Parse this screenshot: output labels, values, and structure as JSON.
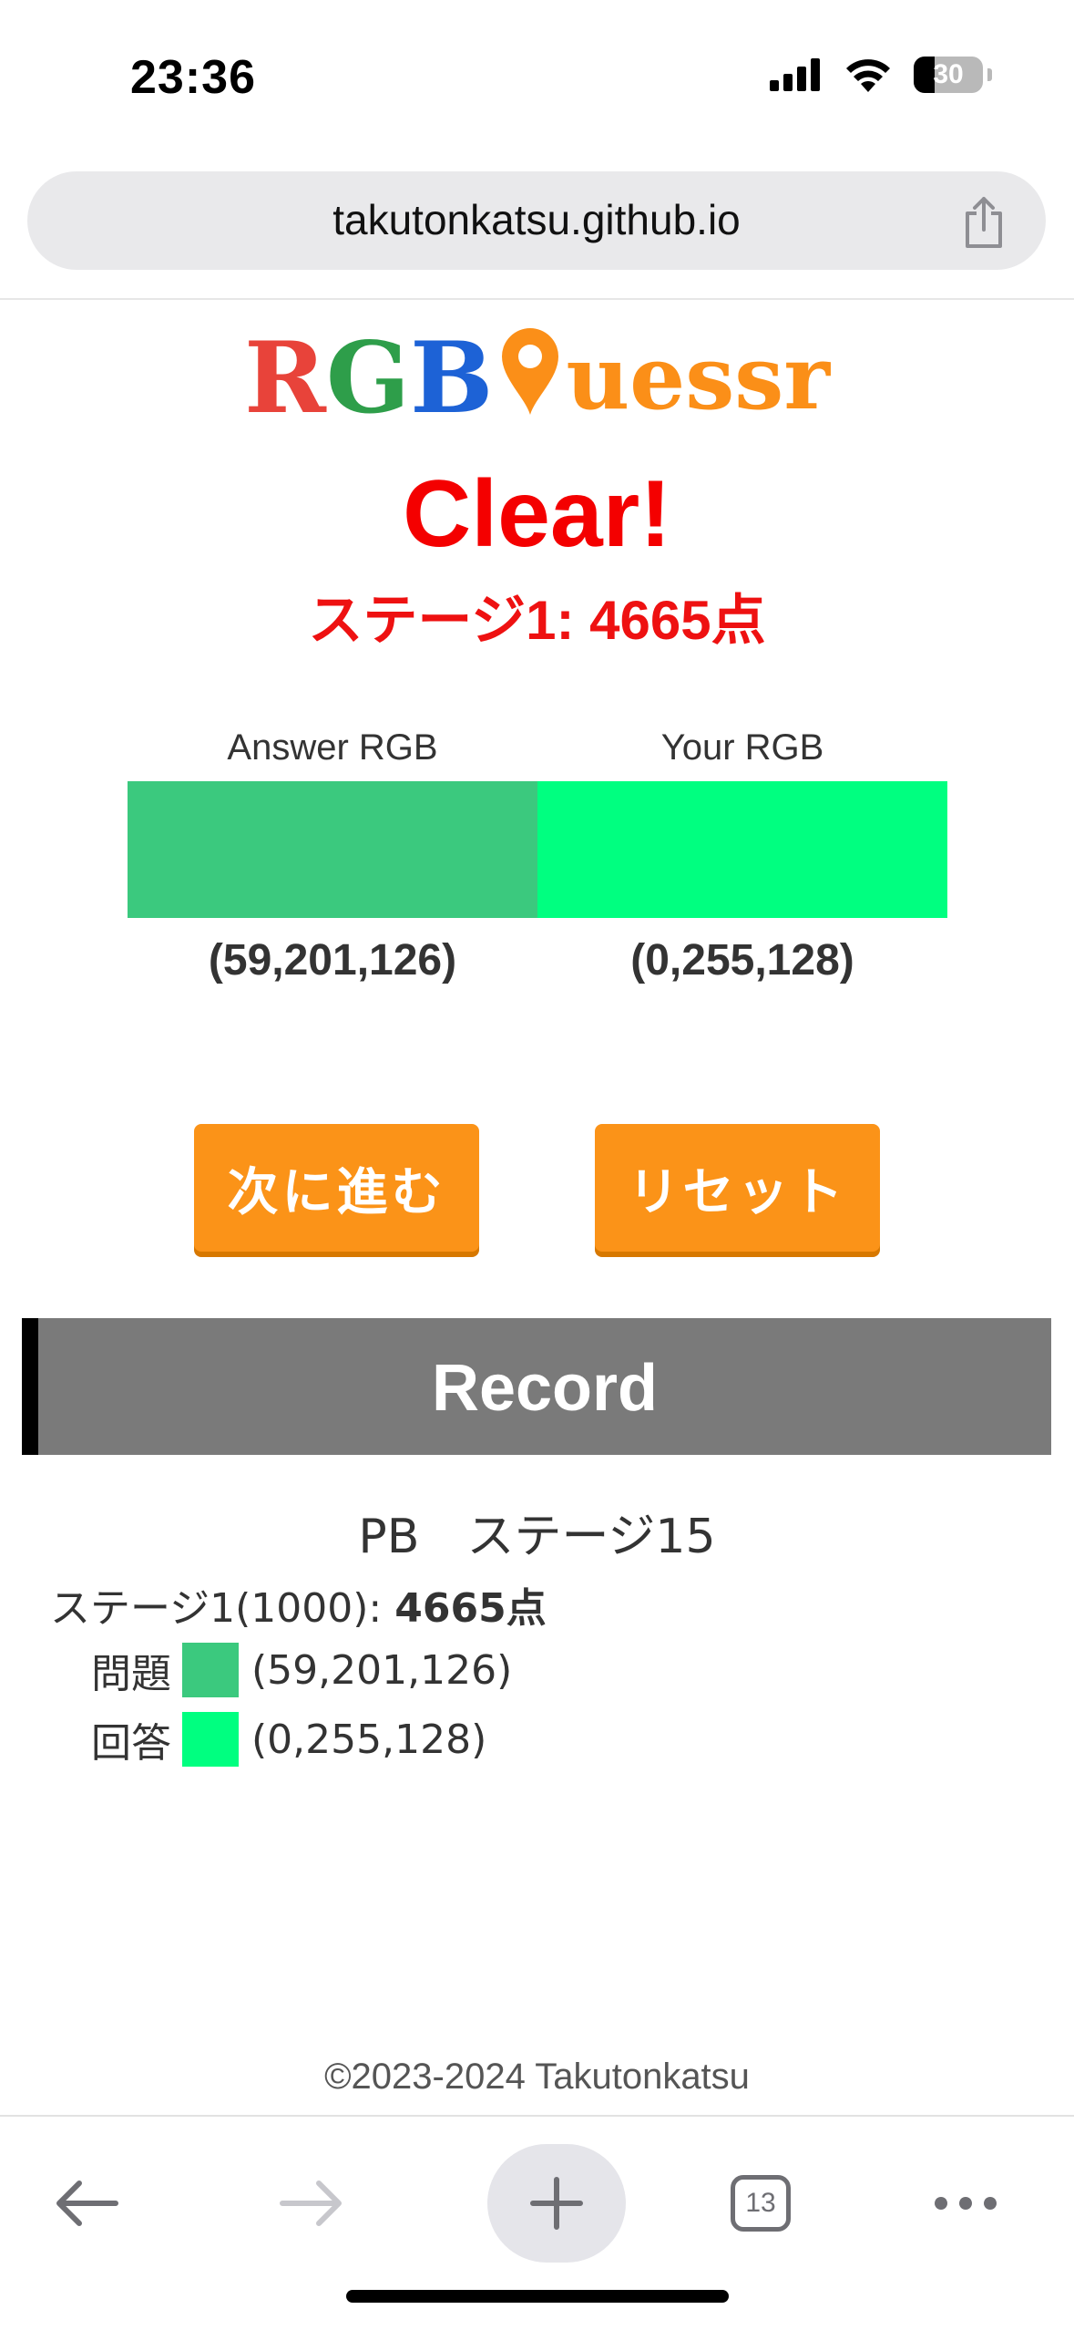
{
  "status": {
    "time": "23:36",
    "battery": "30",
    "battery_level": 0.3
  },
  "browser": {
    "url": "takutonkatsu.github.io",
    "tab_count": "13"
  },
  "logo": {
    "r": "R",
    "g": "G",
    "b": "B",
    "rest": "uessr"
  },
  "result": {
    "title": "Clear!",
    "stage_score": "ステージ1: 4665点"
  },
  "comparison": {
    "answer_label": "Answer RGB",
    "your_label": "Your RGB",
    "answer_color": "#3bc97e",
    "your_color": "#00ff80",
    "answer_value": "(59,201,126)",
    "your_value": "(0,255,128)"
  },
  "buttons": {
    "next": "次に進む",
    "reset": "リセット"
  },
  "record": {
    "title": "Record",
    "pb": "PB　ステージ15",
    "stage_prefix": "ステージ1(1000): ",
    "stage_score": "4665点",
    "question_label": "問題",
    "question_color": "#3bc97e",
    "question_value": "(59,201,126)",
    "answer_label": "回答",
    "answer_color": "#00ff80",
    "answer_value": "(0,255,128)"
  },
  "footer": "©2023-2024 Takutonkatsu",
  "colors": {
    "accent_orange": "#fb9318",
    "clear_red": "#f40000",
    "record_header": "#7a7a7a"
  }
}
